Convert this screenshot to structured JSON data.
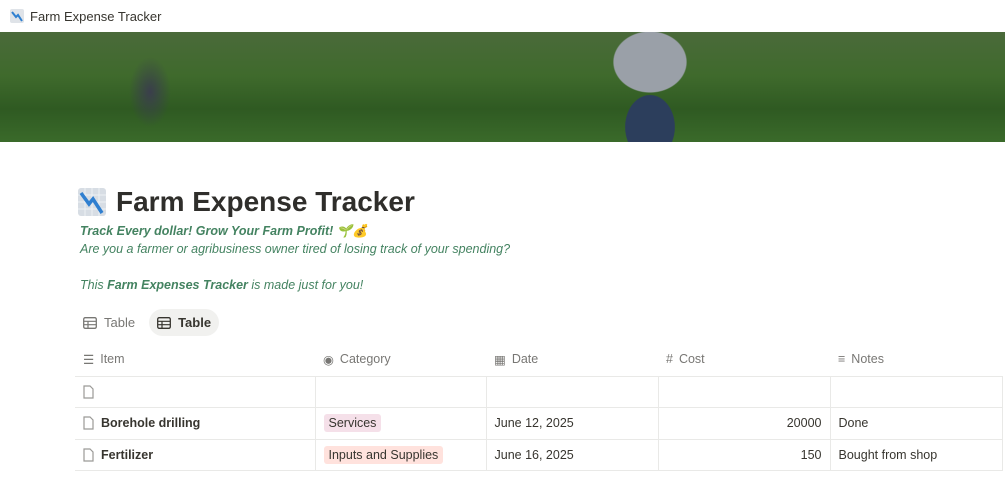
{
  "window": {
    "title": "Farm Expense Tracker",
    "icon": "chart-decreasing-icon"
  },
  "page": {
    "title": "Farm Expense Tracker",
    "tagline": "Track Every dollar! Grow Your Farm Profit! 🌱💰",
    "question": "Are you a farmer or agribusiness owner tired of losing track of your spending?",
    "made_prefix": "This ",
    "made_bold": "Farm Expenses Tracker",
    "made_suffix": " is made just for you!"
  },
  "views": [
    {
      "label": "Table",
      "active": false
    },
    {
      "label": "Table",
      "active": true
    }
  ],
  "table": {
    "columns": [
      {
        "label": "Item",
        "icon": "checklist-icon"
      },
      {
        "label": "Category",
        "icon": "select-icon"
      },
      {
        "label": "Date",
        "icon": "calendar-icon"
      },
      {
        "label": "Cost",
        "icon": "hash-icon"
      },
      {
        "label": "Notes",
        "icon": "text-lines-icon"
      }
    ],
    "rows": [
      {
        "item": "",
        "category": "",
        "date": "",
        "cost": "",
        "notes": ""
      },
      {
        "item": "Borehole drilling",
        "category": "Services",
        "category_color": "#f5e0e9",
        "date": "June 12, 2025",
        "cost": "20000",
        "notes": "Done"
      },
      {
        "item": "Fertilizer",
        "category": "Inputs and Supplies",
        "category_color": "#ffe2dd",
        "date": "June 16, 2025",
        "cost": "150",
        "notes": "Bought from shop"
      }
    ]
  }
}
